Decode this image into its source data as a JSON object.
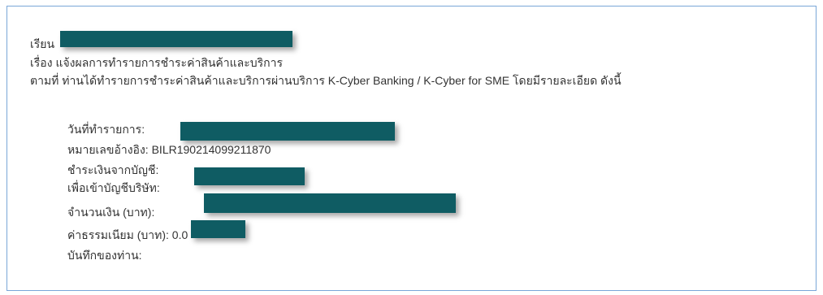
{
  "email": {
    "greeting_label": "เรียน",
    "subject_line": "เรื่อง แจ้งผลการทำรายการชำระค่าสินค้าและบริการ",
    "intro_line": "ตามที่ ท่านได้ทำรายการชำระค่าสินค้าและบริการผ่านบริการ K-Cyber Banking / K-Cyber for SME โดยมีรายละเอียด ดังนี้",
    "details": {
      "transaction_date_label": "วันที่ทำรายการ:",
      "reference_label": "หมายเลขอ้างอิง: BILR190214099211870",
      "from_account_label": "ชำระเงินจากบัญชี:",
      "to_company_account_label": "เพื่อเข้าบัญชีบริษัท:",
      "amount_label": "จำนวนเงิน (บาท):",
      "fee_label": "ค่าธรรมเนียม (บาท): 0.0",
      "memo_label": "บันทึกของท่าน:"
    }
  },
  "colors": {
    "redaction": "#0f5c63",
    "frame_border": "#7aa6d8"
  }
}
